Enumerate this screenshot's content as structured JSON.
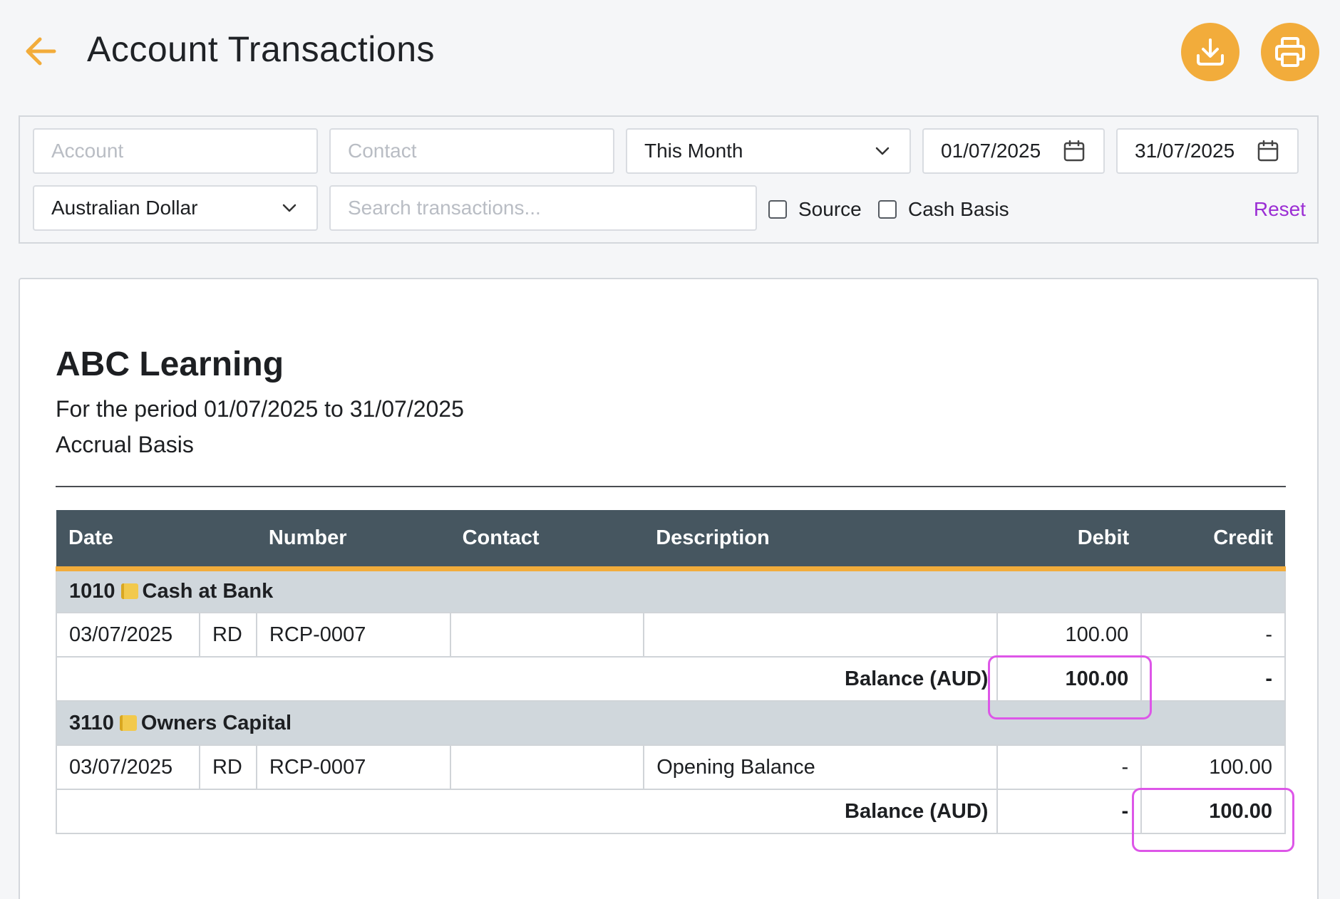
{
  "header": {
    "title": "Account Transactions",
    "back_icon": "arrow-left-icon",
    "download_icon": "download-icon",
    "print_icon": "printer-icon",
    "accent_color": "#f2ac3b"
  },
  "filters": {
    "account_placeholder": "Account",
    "contact_placeholder": "Contact",
    "period_value": "This Month",
    "date_from": "01/07/2025",
    "date_to": "31/07/2025",
    "currency_value": "Australian Dollar",
    "search_placeholder": "Search transactions...",
    "source_label": "Source",
    "source_checked": false,
    "cash_basis_label": "Cash Basis",
    "cash_basis_checked": false,
    "reset_label": "Reset"
  },
  "report": {
    "org_name": "ABC Learning",
    "period": "For the period 01/07/2025 to 31/07/2025",
    "basis": "Accrual Basis",
    "columns": {
      "date": "Date",
      "number": "Number",
      "contact": "Contact",
      "description": "Description",
      "debit": "Debit",
      "credit": "Credit"
    },
    "groups": [
      {
        "code": "1010",
        "name": "Cash at Bank",
        "rows": [
          {
            "date": "03/07/2025",
            "type": "RD",
            "number": "RCP-0007",
            "contact": "",
            "description": "",
            "debit": "100.00",
            "credit": "-"
          }
        ],
        "balance_label": "Balance (AUD)",
        "balance_debit": "100.00",
        "balance_credit": "-"
      },
      {
        "code": "3110",
        "name": "Owners Capital",
        "rows": [
          {
            "date": "03/07/2025",
            "type": "RD",
            "number": "RCP-0007",
            "contact": "",
            "description": "Opening Balance",
            "debit": "-",
            "credit": "100.00"
          }
        ],
        "balance_label": "Balance (AUD)",
        "balance_debit": "-",
        "balance_credit": "100.00"
      }
    ]
  }
}
